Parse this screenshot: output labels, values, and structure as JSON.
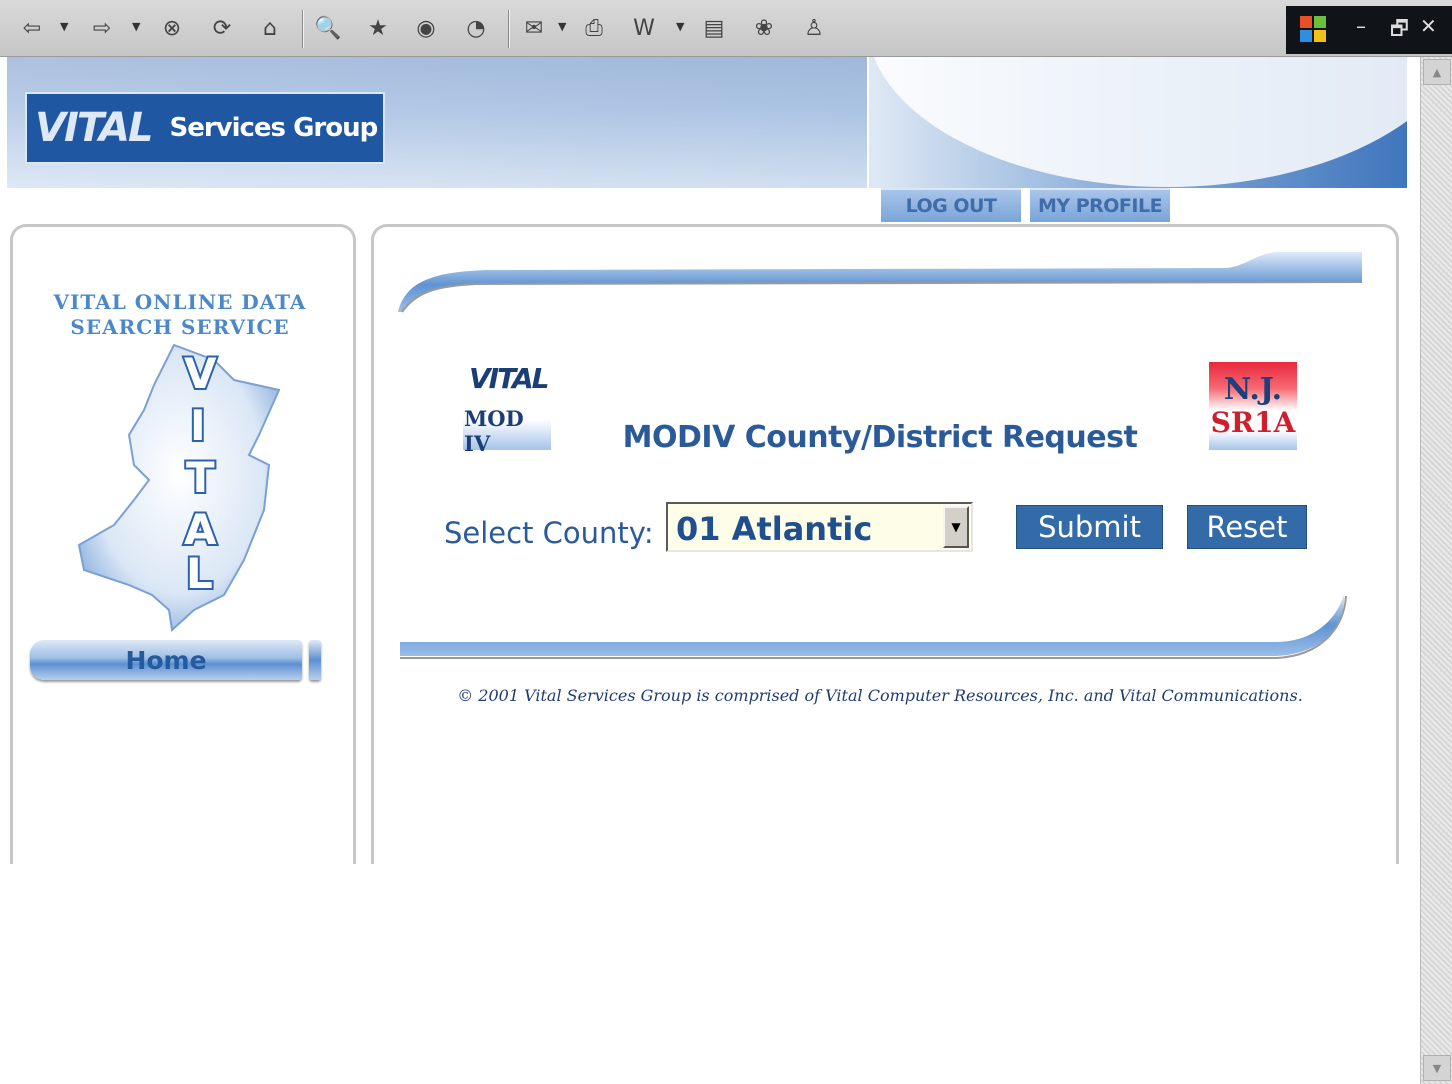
{
  "window": {
    "controls": [
      "–",
      "🗗",
      "✕"
    ]
  },
  "header": {
    "logo_text": "VITAL",
    "brand": "Services Group",
    "tabs": [
      {
        "label": "LOG OUT"
      },
      {
        "label": "MY PROFILE"
      }
    ]
  },
  "sidebar": {
    "title_line1": "VITAL ONLINE DATA",
    "title_line2": "SEARCH SERVICE",
    "map_letters": [
      "V",
      "I",
      "T",
      "A",
      "L"
    ],
    "home_label": "Home"
  },
  "form": {
    "left_logo_top": "VITAL",
    "left_logo_bottom": "MOD IV",
    "right_logo_top": "N.J.",
    "right_logo_bottom": "SR1A",
    "title": "MODIV County/District Request",
    "county_label": "Select County:",
    "county_selected": "01 Atlantic",
    "submit_label": "Submit",
    "reset_label": "Reset"
  },
  "footer": {
    "copyright": "© 2001 Vital Services Group is comprised of Vital Computer Resources, Inc. and Vital Communications."
  },
  "colors": {
    "brand_blue": "#1f57a3",
    "title_blue": "#2b5a99",
    "button_blue": "#336ba8",
    "select_bg": "#fefde8"
  }
}
